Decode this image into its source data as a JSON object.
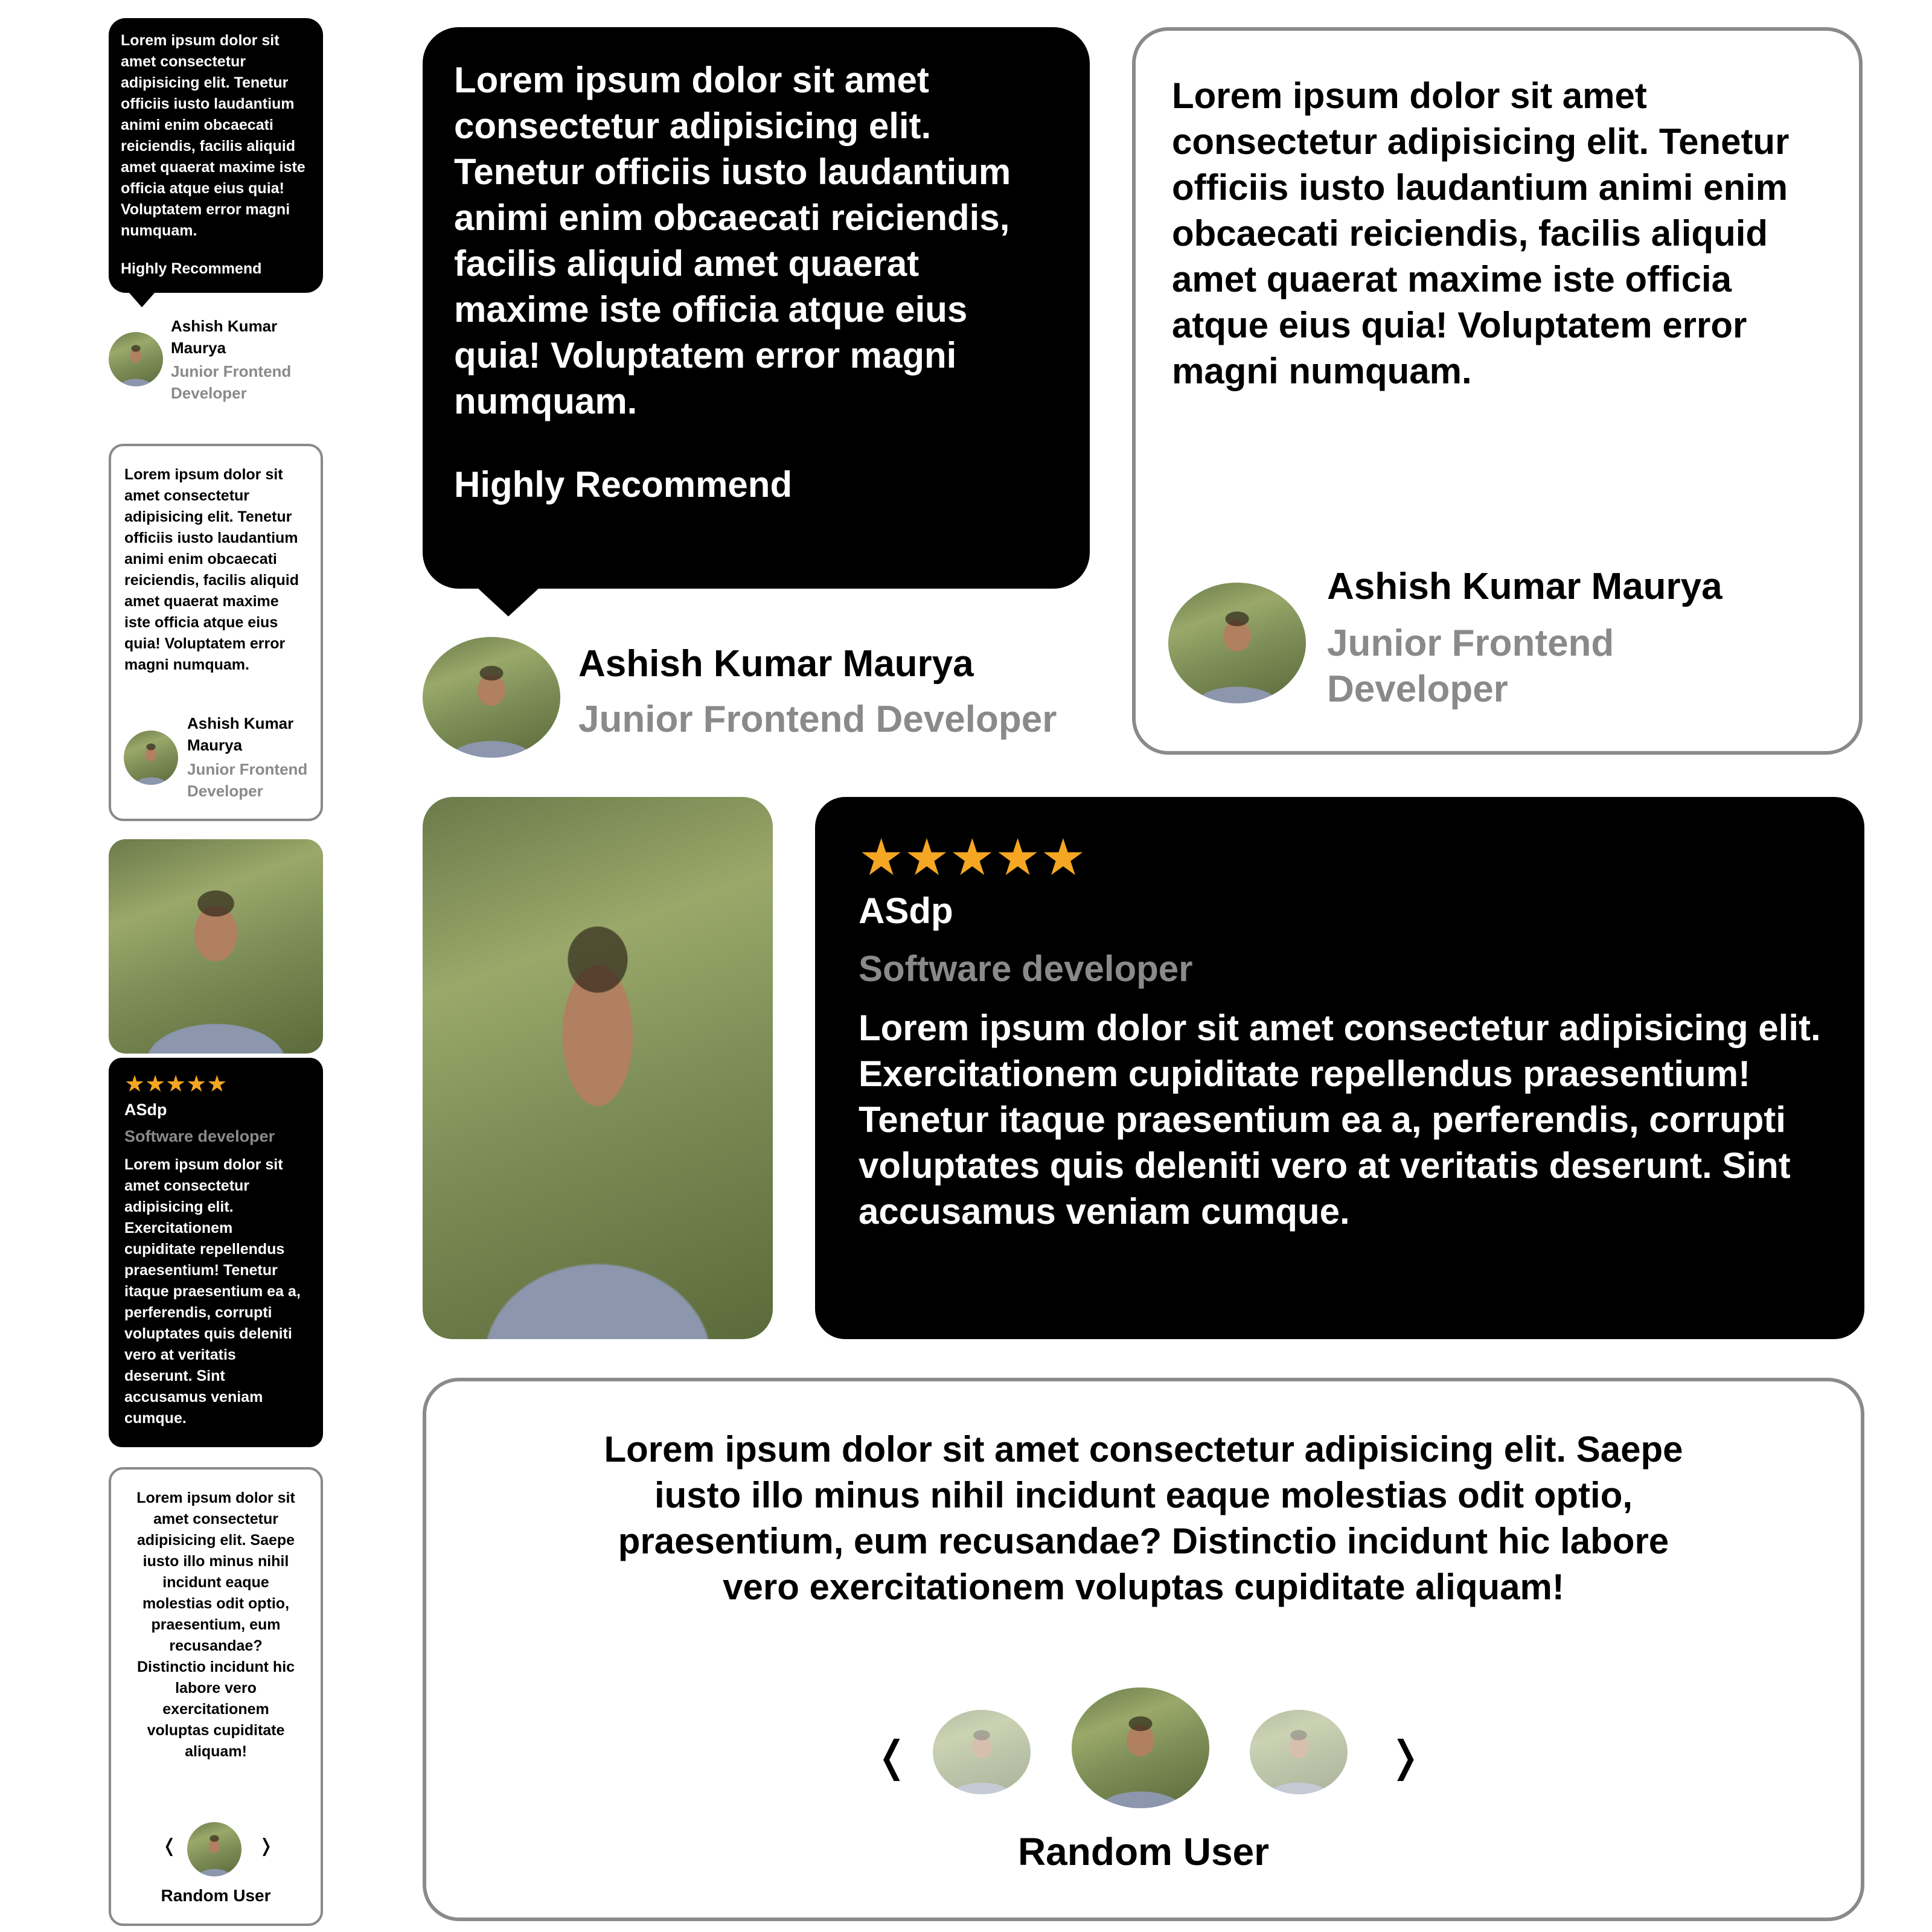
{
  "testimonials": {
    "bubble": {
      "quote": "Lorem ipsum dolor sit amet consectetur adipisicing elit. Tenetur officiis iusto laudantium animi enim obcaecati reiciendis, facilis aliquid amet quaerat maxime iste officia atque eius quia! Voluptatem error magni numquam.",
      "recommend": "Highly Recommend",
      "name": "Ashish Kumar Maurya",
      "role": "Junior Frontend Developer"
    },
    "outlined": {
      "quote": "Lorem ipsum dolor sit amet consectetur adipisicing elit. Tenetur officiis iusto laudantium animi enim obcaecati reiciendis, facilis aliquid amet quaerat maxime iste officia atque eius quia! Voluptatem error magni numquam.",
      "name": "Ashish Kumar Maurya",
      "role": "Junior Frontend Developer"
    },
    "rated": {
      "rating": 5,
      "max_rating": 5,
      "stars": [
        "★",
        "★",
        "★",
        "★",
        "★"
      ],
      "name": "ASdp",
      "role": "Software developer",
      "quote": "Lorem ipsum dolor sit amet consectetur adipisicing elit. Exercitationem cupiditate repellendus praesentium! Tenetur itaque praesentium ea a, perferendis, corrupti voluptates quis deleniti vero at veritatis deserunt. Sint accusamus veniam cumque."
    },
    "carousel": {
      "quote": "Lorem ipsum dolor sit amet consectetur adipisicing elit. Saepe iusto illo minus nihil incidunt eaque molestias odit optio, praesentium, eum recusandae? Distinctio incidunt hic labore vero exercitationem voluptas cupiditate aliquam!",
      "prev": "❬",
      "next": "❭",
      "name": "Random User"
    }
  },
  "colors": {
    "dark_bg": "#000000",
    "border": "#8a8a8a",
    "muted_text": "#8a8a8a",
    "star": "#f5a623"
  },
  "icons": {
    "star": "star-icon",
    "prev": "chevron-left-icon",
    "next": "chevron-right-icon"
  }
}
